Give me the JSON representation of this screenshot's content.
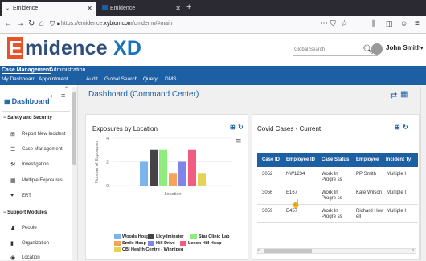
{
  "browser": {
    "tabs": [
      {
        "title": "Emidence",
        "active": true
      },
      {
        "title": "Emidence",
        "active": false
      }
    ],
    "url_prefix": "https://emidence.",
    "url_domain": "xybion.com",
    "url_path": "/cmdemo/#main",
    "icons": [
      "back-icon",
      "forward-icon",
      "reload-icon",
      "home-icon",
      "shield-icon",
      "lock-icon",
      "more-icon",
      "bookmark-icon",
      "star-icon",
      "library-icon",
      "sidebar-icon",
      "account-icon",
      "menu-icon"
    ]
  },
  "header": {
    "logo_letter": "E",
    "logo_word": "midence",
    "logo_suffix": "XD",
    "search_placeholder": "Global Search",
    "user_name": "John Smith"
  },
  "menu": {
    "top": [
      "Case Management",
      "Administration"
    ],
    "sub": [
      "My Dashboard",
      "Appointment",
      "Audit",
      "Global Search",
      "Query",
      "DMS"
    ]
  },
  "sidebar": {
    "title": "Dashboard",
    "sections": [
      {
        "label": "Safety and Security",
        "items": [
          {
            "label": "Report New Incident",
            "icon": "plus-square-icon"
          },
          {
            "label": "Case Management",
            "icon": "list-icon"
          },
          {
            "label": "Investigation",
            "icon": "wrench-icon"
          },
          {
            "label": "Multiple Exposures",
            "icon": "grid-icon"
          },
          {
            "label": "ERT",
            "icon": "heartbeat-icon"
          }
        ]
      },
      {
        "label": "Support Modules",
        "items": [
          {
            "label": "People",
            "icon": "person-icon"
          },
          {
            "label": "Organization",
            "icon": "building-icon"
          },
          {
            "label": "Location",
            "icon": "location-icon"
          }
        ]
      }
    ]
  },
  "main": {
    "title": "Dashboard (Command Center)"
  },
  "exposures_card": {
    "title": "Exposures by Location"
  },
  "chart_data": {
    "type": "bar",
    "title": "",
    "xlabel": "Location",
    "ylabel": "Number of Exposures",
    "ylim": [
      0,
      4
    ],
    "yticks": [
      0,
      2,
      4
    ],
    "grid": true,
    "legend_position": "bottom",
    "series": [
      {
        "name": "Woods Hosp",
        "value": 2,
        "color": "#7cb5ec"
      },
      {
        "name": "Lloydminster",
        "value": 3,
        "color": "#434348"
      },
      {
        "name": "Star Clinic Lab",
        "value": 3,
        "color": "#90ed7d"
      },
      {
        "name": "Smile Hosp",
        "value": 1,
        "color": "#f7a35c"
      },
      {
        "name": "Hill Drive",
        "value": 2,
        "color": "#8085e9"
      },
      {
        "name": "Lenox Hill Hosp",
        "value": 3,
        "color": "#f15c80"
      },
      {
        "name": "CBI Health Centre - Winnipeg",
        "value": 1,
        "color": "#e4d354"
      }
    ],
    "bar_order": [
      "Woods Hosp",
      "Lloydminster",
      "Star Clinic Lab",
      "Smile Hosp",
      "Hill Drive",
      "Lenox Hill Hosp",
      "CBI Health Centre - Winnipeg"
    ]
  },
  "covid_card": {
    "title": "Covid Cases - Current",
    "columns": [
      "Case ID",
      "Employee ID",
      "Case Status",
      "Employee",
      "Incident Ty"
    ],
    "rows": [
      [
        "3052",
        "NW1234",
        "Work In Progre ss",
        "PP Smith",
        "Multiple I"
      ],
      [
        "3056",
        "E167",
        "Work In Progre ss",
        "Kate Wilson",
        "Multiple I"
      ],
      [
        "3059",
        "E457",
        "Work In Progre ss",
        "Richard How ell",
        "Multiple I"
      ]
    ]
  }
}
